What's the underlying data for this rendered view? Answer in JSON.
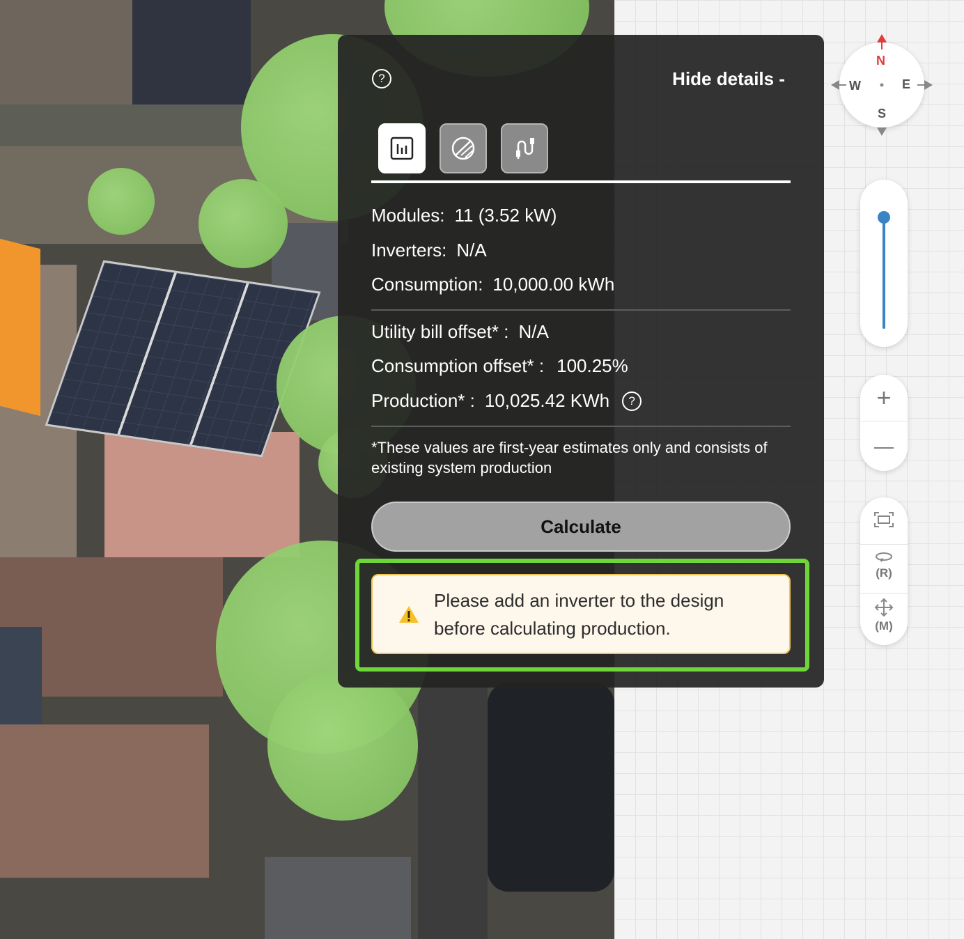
{
  "panel": {
    "hide_details_label": "Hide details -",
    "modules_label": "Modules:",
    "modules_value": "11 (3.52 kW)",
    "inverters_label": "Inverters:",
    "inverters_value": "N/A",
    "consumption_label": "Consumption:",
    "consumption_value": "10,000.00 kWh",
    "utility_offset_label": "Utility bill offset* :",
    "utility_offset_value": "N/A",
    "consumption_offset_label": "Consumption offset* :",
    "consumption_offset_value": "100.25%",
    "production_label": "Production* :",
    "production_value": "10,025.42 KWh",
    "note": "*These values are first-year estimates only and consists of existing system production",
    "calculate_label": "Calculate",
    "alert_text": "Please add an inverter to the design before calculating production.",
    "help_glyph": "?"
  },
  "compass": {
    "n": "N",
    "s": "S",
    "e": "E",
    "w": "W"
  },
  "zoom": {
    "in_glyph": "+",
    "out_glyph": "—"
  },
  "tools": {
    "rotate_label": "(R)",
    "move_label": "(M)"
  },
  "colors": {
    "highlight": "#6fd63a",
    "alert_border": "#f3c451",
    "accent": "#3a84c4",
    "north": "#e23b3b"
  }
}
